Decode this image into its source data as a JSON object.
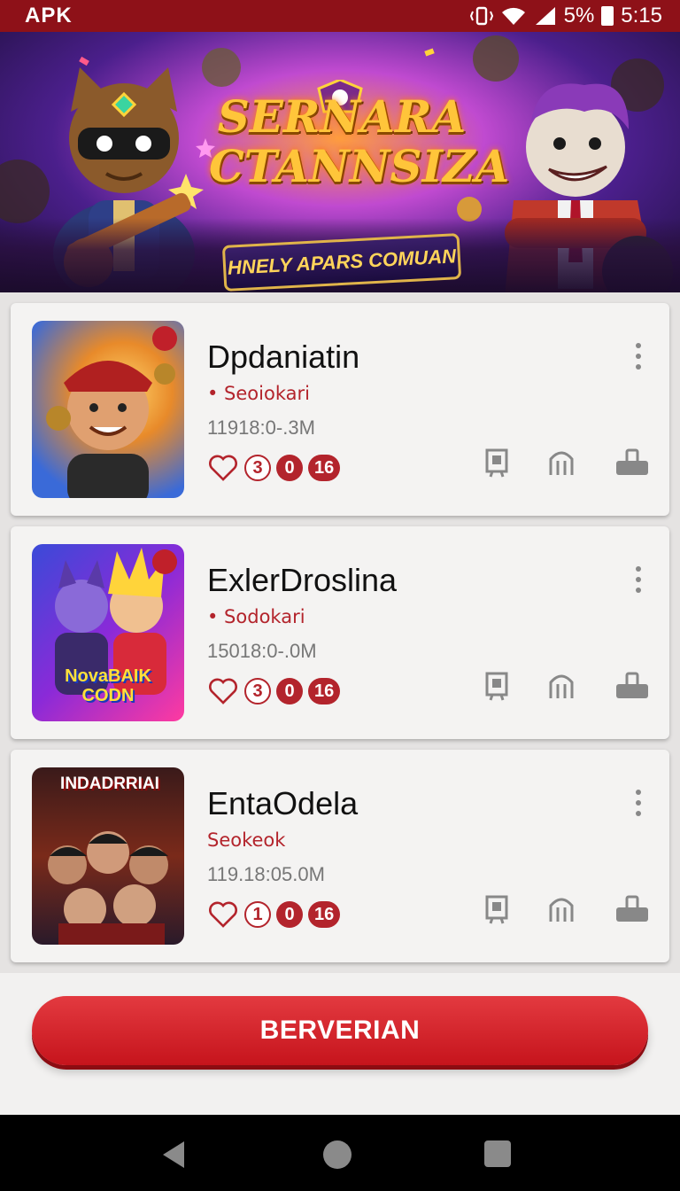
{
  "status_bar": {
    "app_label": "APK",
    "battery": "5%",
    "time": "5:15",
    "icons": [
      "vibrate-icon",
      "wifi-icon",
      "signal-icon",
      "battery-icon"
    ]
  },
  "banner": {
    "title_line1": "SERNARA",
    "title_line2": "CTANNSIZA",
    "subtitle": "HNELY APARS COMUAN"
  },
  "apps": [
    {
      "title": "Dpdaniatin",
      "category": "• Seoiokari",
      "size": "11918:0-.3M",
      "stats": [
        "3",
        "0",
        "16"
      ],
      "thumb_label": ""
    },
    {
      "title": "ExlerDroslina",
      "category": "• Sodokari",
      "size": "15018:0-.0M",
      "stats": [
        "3",
        "0",
        "16"
      ],
      "thumb_label": "NovaBAIK CODN"
    },
    {
      "title": "EntaOdela",
      "category": "Seokeok",
      "size": "119.18:05.0M",
      "stats": [
        "1",
        "0",
        "16"
      ],
      "thumb_label": "INDADRRIAI"
    }
  ],
  "cta": {
    "label": "BERVERIAN"
  },
  "colors": {
    "accent": "#b3242c",
    "status_bar": "#8e1118",
    "button": "#d3232a"
  }
}
